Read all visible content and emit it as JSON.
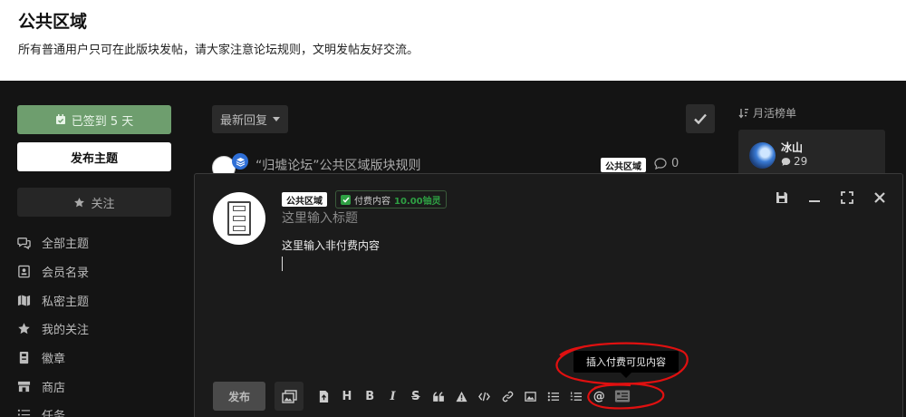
{
  "hero": {
    "title": "公共区域",
    "description": "所有普通用户只可在此版块发帖，请大家注意论坛规则，文明发帖友好交流。"
  },
  "sidebar": {
    "checkin_label": "已签到 5 天",
    "post_label": "发布主题",
    "follow_label": "关注",
    "nav": [
      {
        "label": "全部主题",
        "icon": "chat-bubbles-icon"
      },
      {
        "label": "会员名录",
        "icon": "member-card-icon"
      },
      {
        "label": "私密主题",
        "icon": "map-icon"
      },
      {
        "label": "我的关注",
        "icon": "star-icon"
      },
      {
        "label": "徽章",
        "icon": "badge-icon"
      },
      {
        "label": "商店",
        "icon": "store-icon"
      },
      {
        "label": "任务",
        "icon": "task-list-icon"
      }
    ]
  },
  "list": {
    "sort_label": "最新回复",
    "thread": {
      "title": "“归墟论坛”公共区域版块规则",
      "tag": "公共区域",
      "replies": "0"
    }
  },
  "ranking": {
    "title": "月活榜单",
    "user": {
      "name": "冰山",
      "count": "29"
    }
  },
  "composer": {
    "tag": "公共区域",
    "paid_label": "付费内容",
    "paid_amount": "10.00铀灵",
    "title_placeholder": "这里输入标题",
    "content": "这里输入非付费内容",
    "tooltip": "插入付费可见内容",
    "publish_label": "发布",
    "tools": [
      {
        "name": "upload-file-icon",
        "glyph": ""
      },
      {
        "name": "heading-icon",
        "glyph": "H"
      },
      {
        "name": "bold-icon",
        "glyph": "B"
      },
      {
        "name": "italic-icon",
        "glyph": "I"
      },
      {
        "name": "strikethrough-icon",
        "glyph": "S"
      },
      {
        "name": "quote-icon",
        "glyph": "“"
      },
      {
        "name": "spoiler-icon",
        "glyph": ""
      },
      {
        "name": "code-icon",
        "glyph": "</>"
      },
      {
        "name": "link-icon",
        "glyph": ""
      },
      {
        "name": "image-icon",
        "glyph": ""
      },
      {
        "name": "bullet-list-icon",
        "glyph": ""
      },
      {
        "name": "ordered-list-icon",
        "glyph": ""
      },
      {
        "name": "mention-icon",
        "glyph": "@"
      },
      {
        "name": "paid-content-icon",
        "glyph": ""
      }
    ]
  },
  "colors": {
    "checkin_green": "#6e9e6e",
    "paid_green": "#2ea043",
    "annotation_red": "#e01010"
  }
}
